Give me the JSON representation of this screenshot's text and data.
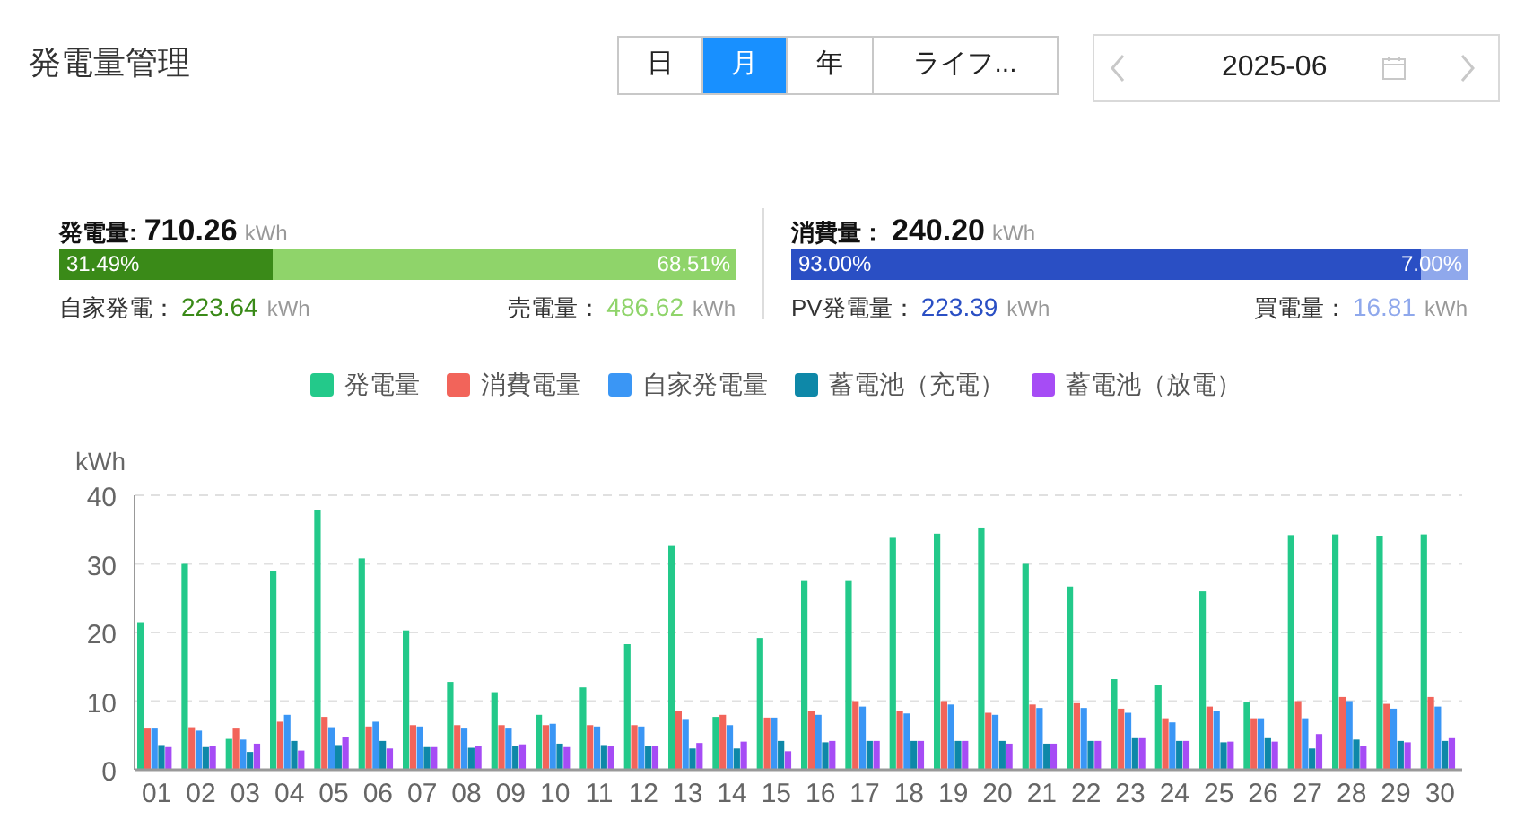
{
  "title": "発電量管理",
  "tabs": [
    {
      "label": "日",
      "selected": false
    },
    {
      "label": "月",
      "selected": true
    },
    {
      "label": "年",
      "selected": false
    },
    {
      "label": "ライフ...",
      "selected": false
    }
  ],
  "date_picker": {
    "value": "2025-06"
  },
  "summaries": [
    {
      "label": "発電量:",
      "value": "710.26",
      "unit": "kWh",
      "bar": [
        {
          "text": "31.49%",
          "level": 0.3149,
          "color": "#3a8a18"
        },
        {
          "text": "68.51%",
          "level": 0.6851,
          "color": "#8fd46a"
        }
      ],
      "details": [
        {
          "label": "自家発電：",
          "value": "223.64",
          "unit": "kWh",
          "color": "#3a8a18"
        },
        {
          "label": "売電量：",
          "value": "486.62",
          "unit": "kWh",
          "color": "#8fd46a"
        }
      ]
    },
    {
      "label": "消費量：",
      "value": "240.20",
      "unit": "kWh",
      "bar": [
        {
          "text": "93.00%",
          "level": 0.93,
          "color": "#2a4fc4"
        },
        {
          "text": "7.00%",
          "level": 0.07,
          "color": "#8fa8ec"
        }
      ],
      "details": [
        {
          "label": "PV発電量：",
          "value": "223.39",
          "unit": "kWh",
          "color": "#2a4fc4"
        },
        {
          "label": "買電量：",
          "value": "16.81",
          "unit": "kWh",
          "color": "#8fa8ec"
        }
      ]
    }
  ],
  "chart_data": {
    "type": "bar",
    "grid": true,
    "ylabel": "kWh",
    "ylim": [
      0,
      40
    ],
    "yticks": [
      0,
      10,
      20,
      30,
      40
    ],
    "categories": [
      "01",
      "02",
      "03",
      "04",
      "05",
      "06",
      "07",
      "08",
      "09",
      "10",
      "11",
      "12",
      "13",
      "14",
      "15",
      "16",
      "17",
      "18",
      "19",
      "20",
      "21",
      "22",
      "23",
      "24",
      "25",
      "26",
      "27",
      "28",
      "29",
      "30"
    ],
    "series": [
      {
        "name": "発電量",
        "color": "#23c98a",
        "values": [
          21.5,
          30,
          4.5,
          29,
          37.8,
          30.8,
          20.3,
          12.8,
          11.3,
          8,
          12,
          18.3,
          32.6,
          7.7,
          19.2,
          27.5,
          27.5,
          33.8,
          34.4,
          35.3,
          30,
          26.7,
          13.2,
          12.3,
          26,
          9.8,
          34.2,
          34.3,
          34.1,
          34.3
        ]
      },
      {
        "name": "消費電量",
        "color": "#f2645a",
        "values": [
          6,
          6.2,
          6,
          7,
          7.7,
          6.3,
          6.5,
          6.5,
          6.5,
          6.5,
          6.5,
          6.5,
          8.6,
          8,
          7.6,
          8.5,
          10,
          8.5,
          10,
          8.3,
          9.5,
          9.7,
          8.9,
          7.5,
          9.2,
          7.5,
          10,
          10.6,
          9.6,
          10.6
        ]
      },
      {
        "name": "自家発電量",
        "color": "#3a96f5",
        "values": [
          6,
          5.7,
          4.4,
          8,
          6.2,
          7,
          6.3,
          6,
          6,
          6.7,
          6.3,
          6.3,
          7.4,
          6.5,
          7.6,
          8,
          9.2,
          8.2,
          9.5,
          8,
          9,
          9,
          8.3,
          6.9,
          8.5,
          7.5,
          7.5,
          10,
          8.9,
          9.2
        ]
      },
      {
        "name": "蓄電池（充電）",
        "color": "#0e88a8",
        "values": [
          3.6,
          3.3,
          2.6,
          4.2,
          3.6,
          4.2,
          3.3,
          3.2,
          3.4,
          3.8,
          3.6,
          3.5,
          3.1,
          3.1,
          4.2,
          4,
          4.2,
          4.2,
          4.2,
          4.2,
          3.8,
          4.2,
          4.6,
          4.2,
          4,
          4.6,
          3.1,
          4.4,
          4.2,
          4.2
        ]
      },
      {
        "name": "蓄電池（放電）",
        "color": "#a64cf5",
        "values": [
          3.3,
          3.5,
          3.8,
          2.8,
          4.8,
          3.1,
          3.3,
          3.5,
          3.7,
          3.3,
          3.5,
          3.5,
          3.9,
          4.1,
          2.7,
          4.2,
          4.2,
          4.2,
          4.2,
          3.8,
          3.8,
          4.2,
          4.6,
          4.2,
          4.1,
          4.1,
          5.2,
          3.4,
          4,
          4.6
        ]
      }
    ]
  }
}
